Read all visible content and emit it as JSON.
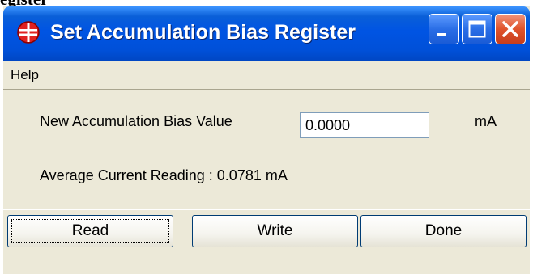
{
  "document": {
    "heading_fragment": "egister"
  },
  "window": {
    "title": "Set Accumulation Bias Register",
    "icon": "app-logo-icon",
    "controls": {
      "minimize_icon": "minimize-icon",
      "maximize_icon": "maximize-icon",
      "close_icon": "close-icon"
    }
  },
  "menu": {
    "items": [
      {
        "label": "Help"
      }
    ]
  },
  "form": {
    "new_value_label": "New Accumulation Bias Value",
    "new_value": "0.0000",
    "unit": "mA",
    "reading_label": "Average Current Reading : 0.0781 mA"
  },
  "buttons": {
    "read": "Read",
    "write": "Write",
    "done": "Done"
  },
  "colors": {
    "titlebar": "#0054e3",
    "close_button": "#e0532b",
    "face": "#ece9d8"
  }
}
